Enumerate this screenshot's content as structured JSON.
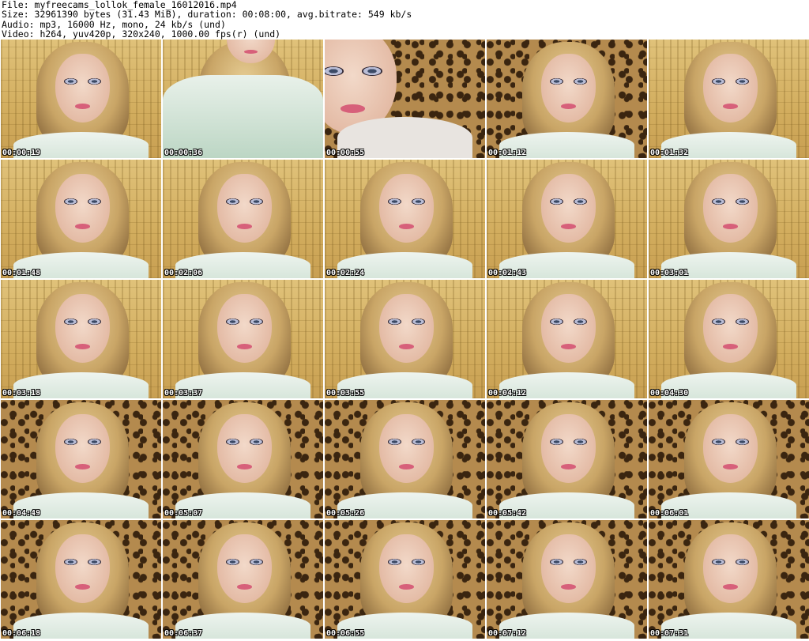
{
  "header": {
    "file": "File: myfreecams_lollok_female_16012016.mp4",
    "size": "Size: 32961390 bytes (31.43 MiB), duration: 00:08:00, avg.bitrate: 549 kb/s",
    "audio": "Audio: mp3, 16000 Hz, mono, 24 kb/s (und)",
    "video": "Video: h264, yuv420p, 320x240, 1000.00 fps(r) (und)"
  },
  "thumbnails": [
    {
      "time": "00:00:19",
      "bg": "bamboo",
      "variant": "face"
    },
    {
      "time": "00:00:36",
      "bg": "bamboo",
      "variant": "body"
    },
    {
      "time": "00:00:55",
      "bg": "leopard",
      "variant": "close"
    },
    {
      "time": "00:01:12",
      "bg": "leopard",
      "variant": "face"
    },
    {
      "time": "00:01:32",
      "bg": "bamboo",
      "variant": "face"
    },
    {
      "time": "00:01:48",
      "bg": "bamboo",
      "variant": "face"
    },
    {
      "time": "00:02:06",
      "bg": "bamboo",
      "variant": "face"
    },
    {
      "time": "00:02:24",
      "bg": "bamboo",
      "variant": "face"
    },
    {
      "time": "00:02:43",
      "bg": "bamboo",
      "variant": "face"
    },
    {
      "time": "00:03:01",
      "bg": "bamboo",
      "variant": "face"
    },
    {
      "time": "00:03:18",
      "bg": "bamboo",
      "variant": "face"
    },
    {
      "time": "00:03:37",
      "bg": "bamboo",
      "variant": "face"
    },
    {
      "time": "00:03:55",
      "bg": "bamboo",
      "variant": "face"
    },
    {
      "time": "00:04:12",
      "bg": "bamboo",
      "variant": "face"
    },
    {
      "time": "00:04:30",
      "bg": "bamboo",
      "variant": "face"
    },
    {
      "time": "00:04:49",
      "bg": "leopard",
      "variant": "face"
    },
    {
      "time": "00:05:07",
      "bg": "leopard",
      "variant": "face"
    },
    {
      "time": "00:05:26",
      "bg": "leopard",
      "variant": "face"
    },
    {
      "time": "00:05:42",
      "bg": "leopard",
      "variant": "face"
    },
    {
      "time": "00:06:01",
      "bg": "leopard",
      "variant": "face"
    },
    {
      "time": "00:06:18",
      "bg": "leopard",
      "variant": "face"
    },
    {
      "time": "00:06:37",
      "bg": "leopard",
      "variant": "face"
    },
    {
      "time": "00:06:55",
      "bg": "leopard",
      "variant": "face"
    },
    {
      "time": "00:07:12",
      "bg": "leopard",
      "variant": "face"
    },
    {
      "time": "00:07:31",
      "bg": "leopard",
      "variant": "face"
    }
  ]
}
